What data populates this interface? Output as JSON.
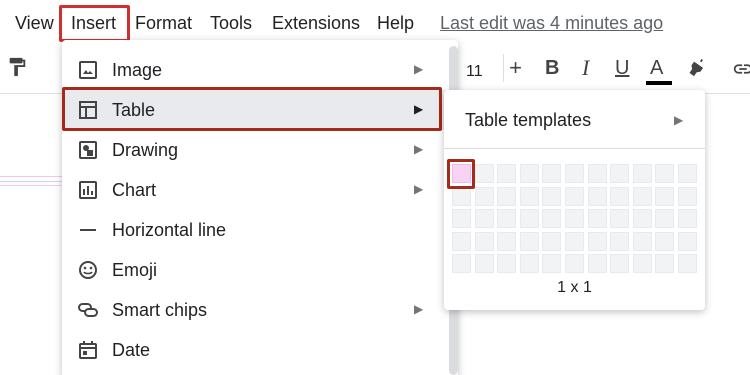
{
  "menubar": {
    "items": [
      "View",
      "Insert",
      "Format",
      "Tools",
      "Extensions",
      "Help"
    ],
    "last_edit": "Last edit was 4 minutes ago"
  },
  "toolbar": {
    "font_size": "11",
    "plus": "+",
    "bold": "B",
    "italic": "I",
    "underline": "U",
    "text_color": "A",
    "icons": [
      "paint-format-icon",
      "highlighter-icon",
      "link-icon"
    ]
  },
  "insert_menu": {
    "items": [
      {
        "label": "Image",
        "icon": "image-icon",
        "has_submenu": true
      },
      {
        "label": "Table",
        "icon": "table-icon",
        "has_submenu": true
      },
      {
        "label": "Drawing",
        "icon": "drawing-icon",
        "has_submenu": true
      },
      {
        "label": "Chart",
        "icon": "chart-icon",
        "has_submenu": true
      },
      {
        "label": "Horizontal line",
        "icon": "horizontal-line-icon",
        "has_submenu": false
      },
      {
        "label": "Emoji",
        "icon": "emoji-icon",
        "has_submenu": false
      },
      {
        "label": "Smart chips",
        "icon": "smart-chips-icon",
        "has_submenu": true
      },
      {
        "label": "Date",
        "icon": "calendar-icon",
        "has_submenu": false
      }
    ],
    "arrow": "▶"
  },
  "table_submenu": {
    "templates_label": "Table templates",
    "arrow": "▶",
    "grid": {
      "columns": 11,
      "rows": 5,
      "selected_columns": 1,
      "selected_rows": 1
    },
    "size_label": "1 x 1"
  },
  "colors": {
    "highlight_red": "#d32f2f",
    "highlight_brown": "#a52a1a",
    "active_item_bg": "#e8eaed",
    "selected_cell": "#f8d3f4"
  }
}
